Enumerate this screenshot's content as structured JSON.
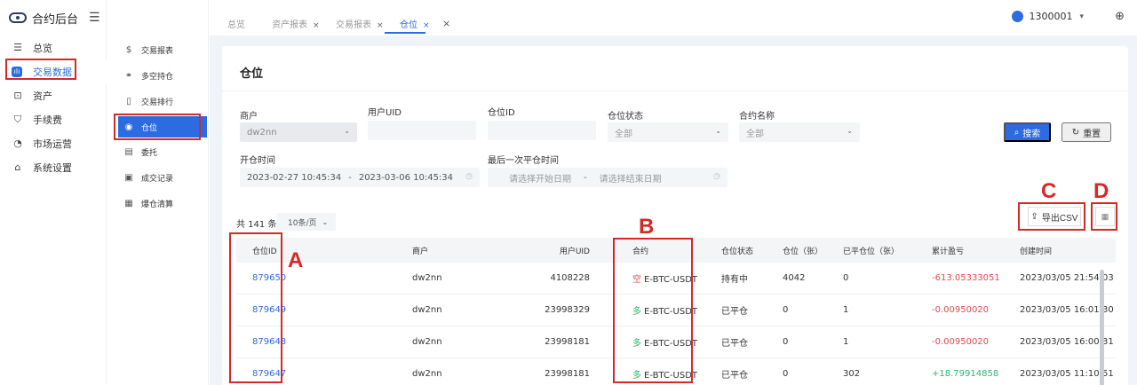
{
  "app": {
    "title": "合约后台"
  },
  "nav_primary": [
    {
      "label": "总览",
      "icon": "menu-icon"
    },
    {
      "label": "交易数据",
      "icon": "chart-icon",
      "active": true
    },
    {
      "label": "资产",
      "icon": "wallet-icon"
    },
    {
      "label": "手续费",
      "icon": "fee-icon"
    },
    {
      "label": "市场运营",
      "icon": "market-icon"
    },
    {
      "label": "系统设置",
      "icon": "settings-icon"
    }
  ],
  "nav_secondary": [
    {
      "label": "交易报表",
      "icon": "dollar-icon"
    },
    {
      "label": "多空持仓",
      "icon": "link-icon"
    },
    {
      "label": "交易排行",
      "icon": "rank-icon"
    },
    {
      "label": "仓位",
      "icon": "position-icon",
      "active": true
    },
    {
      "label": "委托",
      "icon": "order-icon"
    },
    {
      "label": "成交记录",
      "icon": "record-icon"
    },
    {
      "label": "爆仓清算",
      "icon": "liquidation-icon"
    }
  ],
  "tabs": [
    {
      "label": "总览",
      "closable": false
    },
    {
      "label": "资产报表",
      "closable": true
    },
    {
      "label": "交易报表",
      "closable": true
    },
    {
      "label": "仓位",
      "closable": true,
      "active": true
    }
  ],
  "tabs_close_all": "×",
  "user": {
    "name": "1300001"
  },
  "page": {
    "title": "仓位"
  },
  "filters": {
    "merchant_label": "商户",
    "merchant_value": "dw2nn",
    "uid_label": "用户UID",
    "uid_value": "",
    "position_id_label": "仓位ID",
    "position_id_value": "",
    "status_label": "仓位状态",
    "status_value": "全部",
    "contract_label": "合约名称",
    "contract_value": "全部",
    "open_time_label": "开仓时间",
    "open_time_start": "2023-02-27 10:45:34",
    "open_time_sep": "-",
    "open_time_end": "2023-03-06 10:45:34",
    "last_close_label": "最后一次平仓时间",
    "last_close_start_placeholder": "请选择开始日期",
    "last_close_sep": "-",
    "last_close_end_placeholder": "请选择结束日期"
  },
  "actions": {
    "search": "搜索",
    "reset": "重置",
    "export": "导出CSV"
  },
  "summary": {
    "total": "共 141 条",
    "page_size": "10条/页"
  },
  "table": {
    "headers": {
      "id": "仓位ID",
      "merchant": "商户",
      "uid": "用户UID",
      "contract": "合约",
      "status": "仓位状态",
      "position": "仓位（张）",
      "closed": "已平仓位（张）",
      "pnl": "累计盈亏",
      "created": "创建时间"
    },
    "rows": [
      {
        "id": "879650",
        "merchant": "dw2nn",
        "uid": "4108228",
        "side": "空",
        "side_type": "short",
        "contract": "E-BTC-USDT",
        "status": "持有中",
        "position": "4042",
        "closed": "0",
        "pnl": "-613.05333051",
        "pnl_type": "neg",
        "created": "2023/03/05 21:54:03"
      },
      {
        "id": "879649",
        "merchant": "dw2nn",
        "uid": "23998329",
        "side": "多",
        "side_type": "long",
        "contract": "E-BTC-USDT",
        "status": "已平仓",
        "position": "0",
        "closed": "1",
        "pnl": "-0.00950020",
        "pnl_type": "neg",
        "created": "2023/03/05 16:01:30"
      },
      {
        "id": "879648",
        "merchant": "dw2nn",
        "uid": "23998181",
        "side": "多",
        "side_type": "long",
        "contract": "E-BTC-USDT",
        "status": "已平仓",
        "position": "0",
        "closed": "1",
        "pnl": "-0.00950020",
        "pnl_type": "neg",
        "created": "2023/03/05 16:00:31"
      },
      {
        "id": "879647",
        "merchant": "dw2nn",
        "uid": "23998181",
        "side": "多",
        "side_type": "long",
        "contract": "E-BTC-USDT",
        "status": "已平仓",
        "position": "0",
        "closed": "302",
        "pnl": "+18.79914858",
        "pnl_type": "pos",
        "created": "2023/03/05 11:10:51"
      }
    ]
  },
  "annotations": {
    "a": "A",
    "b": "B",
    "c": "C",
    "d": "D"
  },
  "colors": {
    "primary": "#2c6be0",
    "negative": "#e5484d",
    "positive": "#2bb673",
    "annotation": "#d62828"
  }
}
